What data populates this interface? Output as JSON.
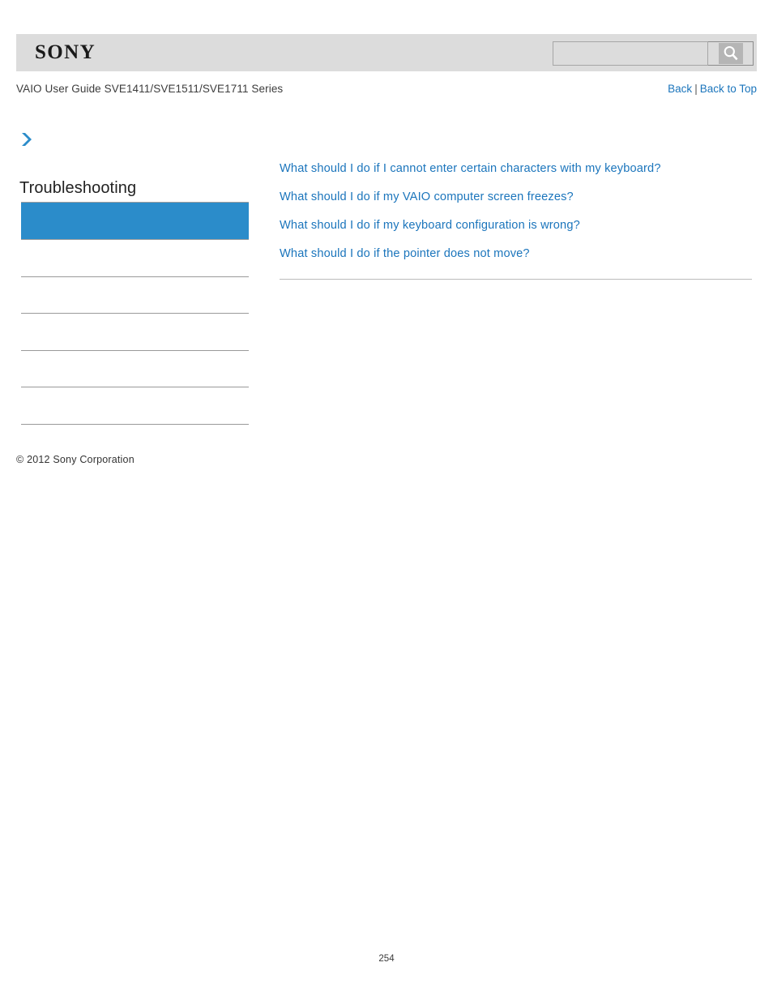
{
  "header": {
    "brand": "SONY",
    "search": {
      "value": "",
      "placeholder": "",
      "icon": "search-icon",
      "button_label": ""
    },
    "guide_title": "VAIO User Guide SVE1411/SVE1511/SVE1711 Series",
    "nav": {
      "back_label": "Back",
      "separator": "|",
      "back_to_top_label": "Back to Top"
    }
  },
  "sidebar": {
    "breadcrumb_icon": "chevron-right-icon",
    "title": "Troubleshooting",
    "current_item": {
      "label": "",
      "color": "#2b8cca"
    },
    "items": [
      {
        "label": ""
      },
      {
        "label": ""
      },
      {
        "label": ""
      },
      {
        "label": ""
      },
      {
        "label": ""
      }
    ]
  },
  "main": {
    "faq_links": [
      {
        "label": "What should I do if I cannot enter certain characters with my keyboard?"
      },
      {
        "label": "What should I do if my VAIO computer screen freezes?"
      },
      {
        "label": "What should I do if my keyboard configuration is wrong?"
      },
      {
        "label": "What should I do if the pointer does not move?"
      }
    ]
  },
  "footer": {
    "copyright": "© 2012 Sony Corporation",
    "page_number": "254"
  },
  "colors": {
    "link": "#1b75bc",
    "accent": "#2b8cca",
    "header_bg": "#dcdcdc",
    "divider": "#9a9a9a"
  }
}
